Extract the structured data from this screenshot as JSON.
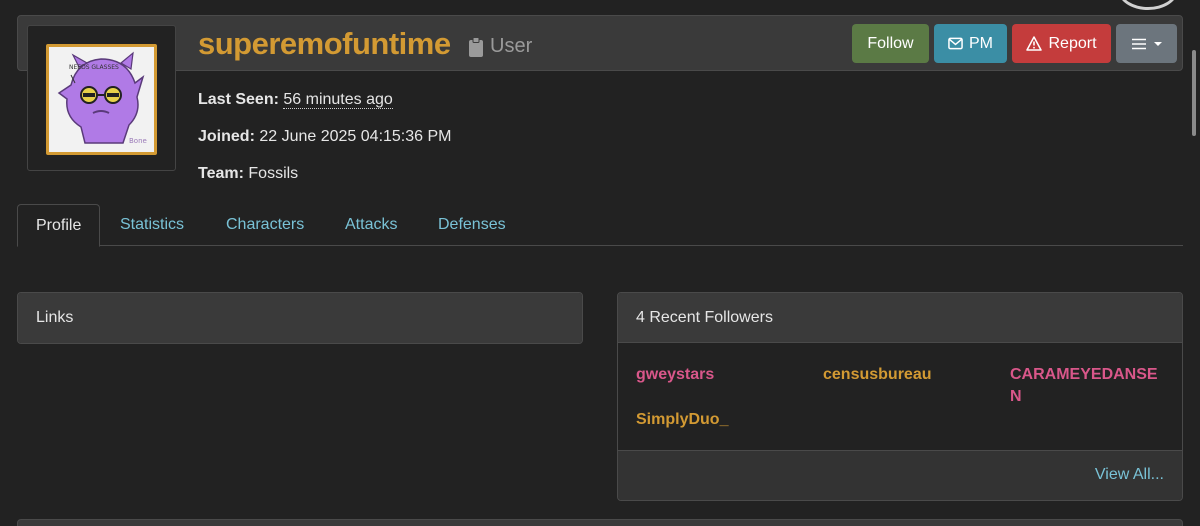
{
  "profile": {
    "username": "superemofuntime",
    "role": "User",
    "avatar_text": "NEEDS GLASSES",
    "avatar_signature": "Bone",
    "last_seen_label": "Last Seen:",
    "last_seen_value": "56 minutes ago",
    "joined_label": "Joined:",
    "joined_value": "22 June 2025 04:15:36 PM",
    "team_label": "Team:",
    "team_value": "Fossils"
  },
  "actions": {
    "follow": "Follow",
    "pm": "PM",
    "report": "Report"
  },
  "tabs": [
    {
      "label": "Profile",
      "active": true
    },
    {
      "label": "Statistics",
      "active": false
    },
    {
      "label": "Characters",
      "active": false
    },
    {
      "label": "Attacks",
      "active": false
    },
    {
      "label": "Defenses",
      "active": false
    }
  ],
  "links_card": {
    "title": "Links"
  },
  "followers_card": {
    "title": "4 Recent Followers",
    "followers": [
      {
        "name": "gweystars",
        "color": "#d9578a"
      },
      {
        "name": "censusbureau",
        "color": "#d39a33"
      },
      {
        "name": "CARAMEYEDANSEN",
        "color": "#d9578a"
      },
      {
        "name": "SimplyDuo_",
        "color": "#d39a33"
      }
    ],
    "view_all": "View All..."
  },
  "colors": {
    "accent_orange": "#d39a33",
    "link_blue": "#79c2d6",
    "follow_green": "#5b7a45",
    "pm_teal": "#3b8ea5",
    "report_red": "#c43c3c",
    "menu_gray": "#6c757d"
  },
  "icons": {
    "role": "clipboard-icon",
    "pm": "envelope-icon",
    "report": "warning-triangle-icon",
    "menu": "hamburger-menu-icon",
    "menu_caret": "caret-down-icon"
  }
}
